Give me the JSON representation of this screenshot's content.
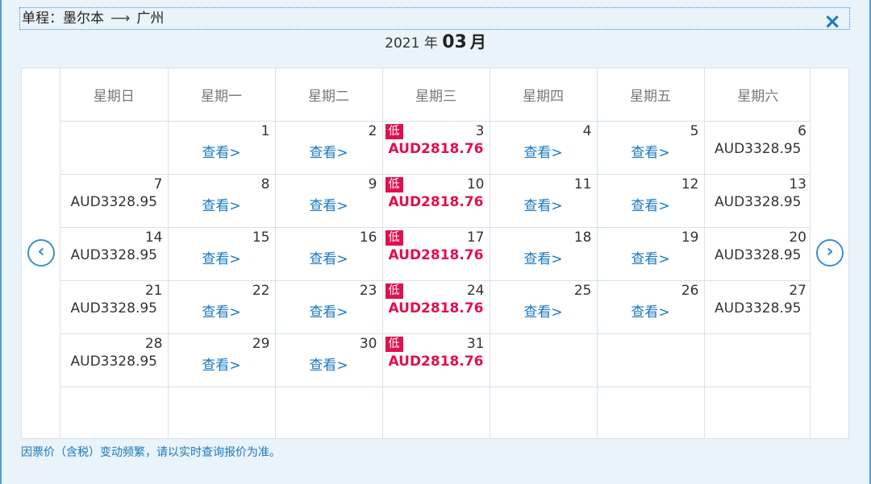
{
  "header": {
    "label": "单程：",
    "origin": "墨尔本",
    "arrow": "⟶",
    "destination": "广州",
    "close_icon": "×"
  },
  "month": {
    "year": "2021",
    "year_unit": "年",
    "month": "03",
    "month_unit": "月"
  },
  "nav": {
    "prev": "‹",
    "next": "›"
  },
  "weekdays": [
    "星期日",
    "星期一",
    "星期二",
    "星期三",
    "星期四",
    "星期五",
    "星期六"
  ],
  "low_badge": "低",
  "view_label": "查看>",
  "weeks": [
    [
      null,
      {
        "d": "1",
        "t": "view"
      },
      {
        "d": "2",
        "t": "view"
      },
      {
        "d": "3",
        "t": "low",
        "p": "AUD2818.76"
      },
      {
        "d": "4",
        "t": "view"
      },
      {
        "d": "5",
        "t": "view"
      },
      {
        "d": "6",
        "t": "price",
        "p": "AUD3328.95"
      }
    ],
    [
      {
        "d": "7",
        "t": "price",
        "p": "AUD3328.95"
      },
      {
        "d": "8",
        "t": "view"
      },
      {
        "d": "9",
        "t": "view"
      },
      {
        "d": "10",
        "t": "low",
        "p": "AUD2818.76"
      },
      {
        "d": "11",
        "t": "view"
      },
      {
        "d": "12",
        "t": "view"
      },
      {
        "d": "13",
        "t": "price",
        "p": "AUD3328.95"
      }
    ],
    [
      {
        "d": "14",
        "t": "price",
        "p": "AUD3328.95"
      },
      {
        "d": "15",
        "t": "view"
      },
      {
        "d": "16",
        "t": "view"
      },
      {
        "d": "17",
        "t": "low",
        "p": "AUD2818.76"
      },
      {
        "d": "18",
        "t": "view"
      },
      {
        "d": "19",
        "t": "view"
      },
      {
        "d": "20",
        "t": "price",
        "p": "AUD3328.95"
      }
    ],
    [
      {
        "d": "21",
        "t": "price",
        "p": "AUD3328.95"
      },
      {
        "d": "22",
        "t": "view"
      },
      {
        "d": "23",
        "t": "view"
      },
      {
        "d": "24",
        "t": "low",
        "p": "AUD2818.76"
      },
      {
        "d": "25",
        "t": "view"
      },
      {
        "d": "26",
        "t": "view"
      },
      {
        "d": "27",
        "t": "price",
        "p": "AUD3328.95"
      }
    ],
    [
      {
        "d": "28",
        "t": "price",
        "p": "AUD3328.95"
      },
      {
        "d": "29",
        "t": "view"
      },
      {
        "d": "30",
        "t": "view"
      },
      {
        "d": "31",
        "t": "low",
        "p": "AUD2818.76"
      },
      null,
      null,
      null
    ],
    [
      null,
      null,
      null,
      null,
      null,
      null,
      null
    ]
  ],
  "footnote": "因票价（含税）变动频繁，请以实时查询报价为准。",
  "colors": {
    "accent": "#1a78c2",
    "low": "#e0104f",
    "background": "#e9f3f9"
  }
}
